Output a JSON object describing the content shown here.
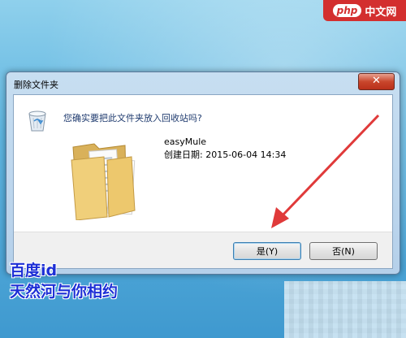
{
  "watermark": {
    "php": "php",
    "site": "中文网"
  },
  "dialog": {
    "title": "删除文件夹",
    "close_glyph": "✕",
    "question": "您确实要把此文件夹放入回收站吗?",
    "item_name": "easyMule",
    "item_created": "创建日期: 2015-06-04 14:34",
    "yes_label": "是(Y)",
    "no_label": "否(N)"
  },
  "caption": {
    "line1": "百度id",
    "line2": "天然河与你相约"
  },
  "colors": {
    "arrow": "#e03a3a",
    "caption": "#1d2fd6",
    "close_button": "#c9462c"
  }
}
